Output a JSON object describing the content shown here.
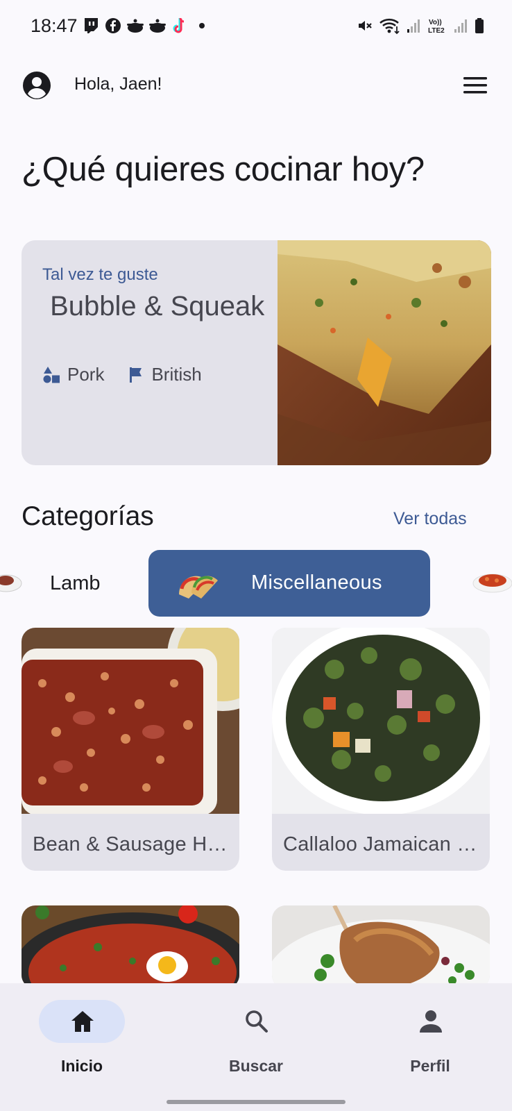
{
  "status_bar": {
    "time": "18:47",
    "left_icons": [
      "twitch-icon",
      "facebook-icon",
      "cooking-pot-icon",
      "cooking-pot-icon",
      "tiktok-icon",
      "dot-icon"
    ],
    "right_icons": [
      "mute-icon",
      "wifi-icon",
      "signal-icon",
      "volte-icon",
      "signal-icon",
      "battery-icon"
    ],
    "volte_label": "Vo)) LTE2"
  },
  "header": {
    "greeting": "Hola, Jaen!"
  },
  "headline": "¿Qué quieres cocinar hoy?",
  "featured": {
    "kicker": "Tal vez te guste",
    "title": " Bubble & Squeak",
    "category": "Pork",
    "area": "British"
  },
  "categories": {
    "title": "Categorías",
    "see_all": "Ver todas",
    "chips": [
      {
        "label": "Lamb",
        "selected": false
      },
      {
        "label": "Miscellaneous",
        "selected": true
      }
    ]
  },
  "recipes": [
    {
      "name": "Bean & Sausage Hotpot"
    },
    {
      "name": "Callaloo Jamaican Style"
    },
    {
      "name": ""
    },
    {
      "name": ""
    }
  ],
  "bottom_nav": {
    "items": [
      {
        "label": "Inicio",
        "icon": "home-icon",
        "active": true
      },
      {
        "label": "Buscar",
        "icon": "search-icon",
        "active": false
      },
      {
        "label": "Perfil",
        "icon": "person-icon",
        "active": false
      }
    ]
  },
  "colors": {
    "accent": "#3e5f96",
    "card_bg": "#e3e2ea",
    "nav_bg": "#efedf4",
    "nav_active_pill": "#dae2f8"
  }
}
